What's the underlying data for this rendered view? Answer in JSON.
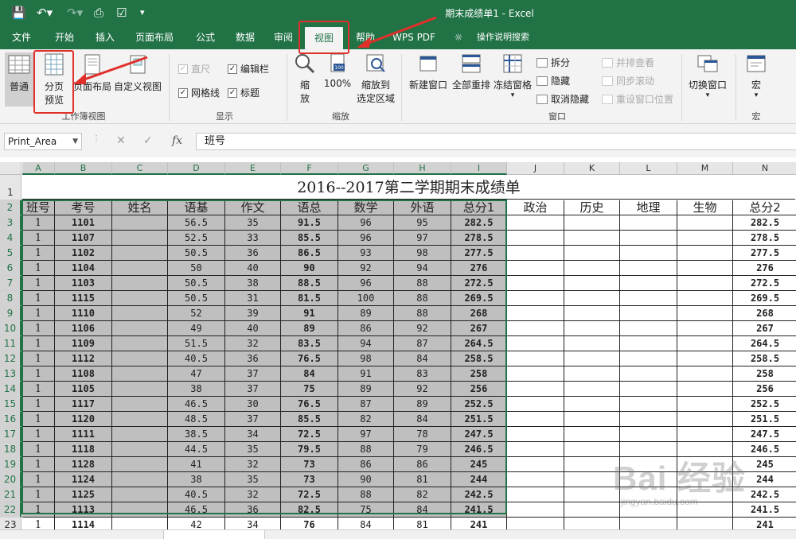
{
  "titlebar": {
    "title": "期末成绩单1  -  Excel"
  },
  "tabs": [
    {
      "label": "文件"
    },
    {
      "label": "开始"
    },
    {
      "label": "插入"
    },
    {
      "label": "页面布局"
    },
    {
      "label": "公式"
    },
    {
      "label": "数据"
    },
    {
      "label": "审阅"
    },
    {
      "label": "视图"
    },
    {
      "label": "帮助"
    },
    {
      "label": "WPS PDF"
    },
    {
      "label": "操作说明搜索"
    }
  ],
  "ribbon": {
    "views": {
      "normal": "普通",
      "page_break_1": "分页",
      "page_break_2": "预览",
      "page_layout": "页面布局",
      "custom_view": "自定义视图",
      "group": "工作簿视图"
    },
    "show": {
      "ruler": "直尺",
      "formula_bar": "编辑栏",
      "gridlines": "网格线",
      "headings": "标题",
      "group": "显示"
    },
    "zoom": {
      "zoom_1": "缩",
      "zoom_2": "放",
      "hundred": "100%",
      "to_sel_1": "缩放到",
      "to_sel_2": "选定区域",
      "group": "缩放"
    },
    "window": {
      "new_window": "新建窗口",
      "arrange_all": "全部重排",
      "freeze": "冻结窗格",
      "split": "拆分",
      "hide": "隐藏",
      "unhide": "取消隐藏",
      "side_by_side": "并排查看",
      "sync_scroll": "同步滚动",
      "reset_pos": "重设窗口位置",
      "switch": "切换窗口",
      "group": "窗口"
    },
    "macros": {
      "label": "宏",
      "group": "宏"
    }
  },
  "formulabar": {
    "namebox": "Print_Area",
    "content": "班号"
  },
  "sheet": {
    "columns": [
      "A",
      "B",
      "C",
      "D",
      "E",
      "F",
      "G",
      "H",
      "I",
      "J",
      "K",
      "L",
      "M",
      "N"
    ],
    "title": "2016--2017第二学期期末成绩单",
    "headers": [
      "班号",
      "考号",
      "姓名",
      "语基",
      "作文",
      "语总",
      "数学",
      "外语",
      "总分1",
      "政治",
      "历史",
      "地理",
      "生物",
      "总分2"
    ],
    "rows": [
      {
        "n": "3",
        "v": [
          "1",
          "1101",
          "",
          "56.5",
          "35",
          "91.5",
          "96",
          "95",
          "282.5",
          "",
          "",
          "",
          "",
          "282.5"
        ]
      },
      {
        "n": "4",
        "v": [
          "1",
          "1107",
          "",
          "52.5",
          "33",
          "85.5",
          "96",
          "97",
          "278.5",
          "",
          "",
          "",
          "",
          "278.5"
        ]
      },
      {
        "n": "5",
        "v": [
          "1",
          "1102",
          "",
          "50.5",
          "36",
          "86.5",
          "93",
          "98",
          "277.5",
          "",
          "",
          "",
          "",
          "277.5"
        ]
      },
      {
        "n": "6",
        "v": [
          "1",
          "1104",
          "",
          "50",
          "40",
          "90",
          "92",
          "94",
          "276",
          "",
          "",
          "",
          "",
          "276"
        ]
      },
      {
        "n": "7",
        "v": [
          "1",
          "1103",
          "",
          "50.5",
          "38",
          "88.5",
          "96",
          "88",
          "272.5",
          "",
          "",
          "",
          "",
          "272.5"
        ]
      },
      {
        "n": "8",
        "v": [
          "1",
          "1115",
          "",
          "50.5",
          "31",
          "81.5",
          "100",
          "88",
          "269.5",
          "",
          "",
          "",
          "",
          "269.5"
        ]
      },
      {
        "n": "9",
        "v": [
          "1",
          "1110",
          "",
          "52",
          "39",
          "91",
          "89",
          "88",
          "268",
          "",
          "",
          "",
          "",
          "268"
        ]
      },
      {
        "n": "10",
        "v": [
          "1",
          "1106",
          "",
          "49",
          "40",
          "89",
          "86",
          "92",
          "267",
          "",
          "",
          "",
          "",
          "267"
        ]
      },
      {
        "n": "11",
        "v": [
          "1",
          "1109",
          "",
          "51.5",
          "32",
          "83.5",
          "94",
          "87",
          "264.5",
          "",
          "",
          "",
          "",
          "264.5"
        ]
      },
      {
        "n": "12",
        "v": [
          "1",
          "1112",
          "",
          "40.5",
          "36",
          "76.5",
          "98",
          "84",
          "258.5",
          "",
          "",
          "",
          "",
          "258.5"
        ]
      },
      {
        "n": "13",
        "v": [
          "1",
          "1108",
          "",
          "47",
          "37",
          "84",
          "91",
          "83",
          "258",
          "",
          "",
          "",
          "",
          "258"
        ]
      },
      {
        "n": "14",
        "v": [
          "1",
          "1105",
          "",
          "38",
          "37",
          "75",
          "89",
          "92",
          "256",
          "",
          "",
          "",
          "",
          "256"
        ]
      },
      {
        "n": "15",
        "v": [
          "1",
          "1117",
          "",
          "46.5",
          "30",
          "76.5",
          "87",
          "89",
          "252.5",
          "",
          "",
          "",
          "",
          "252.5"
        ]
      },
      {
        "n": "16",
        "v": [
          "1",
          "1120",
          "",
          "48.5",
          "37",
          "85.5",
          "82",
          "84",
          "251.5",
          "",
          "",
          "",
          "",
          "251.5"
        ]
      },
      {
        "n": "17",
        "v": [
          "1",
          "1111",
          "",
          "38.5",
          "34",
          "72.5",
          "97",
          "78",
          "247.5",
          "",
          "",
          "",
          "",
          "247.5"
        ]
      },
      {
        "n": "18",
        "v": [
          "1",
          "1118",
          "",
          "44.5",
          "35",
          "79.5",
          "88",
          "79",
          "246.5",
          "",
          "",
          "",
          "",
          "246.5"
        ]
      },
      {
        "n": "19",
        "v": [
          "1",
          "1128",
          "",
          "41",
          "32",
          "73",
          "86",
          "86",
          "245",
          "",
          "",
          "",
          "",
          "245"
        ]
      },
      {
        "n": "20",
        "v": [
          "1",
          "1124",
          "",
          "38",
          "35",
          "73",
          "90",
          "81",
          "244",
          "",
          "",
          "",
          "",
          "244"
        ]
      },
      {
        "n": "21",
        "v": [
          "1",
          "1125",
          "",
          "40.5",
          "32",
          "72.5",
          "88",
          "82",
          "242.5",
          "",
          "",
          "",
          "",
          "242.5"
        ]
      },
      {
        "n": "22",
        "v": [
          "1",
          "1113",
          "",
          "46.5",
          "36",
          "82.5",
          "75",
          "84",
          "241.5",
          "",
          "",
          "",
          "",
          "241.5"
        ]
      },
      {
        "n": "23",
        "v": [
          "1",
          "1114",
          "",
          "42",
          "34",
          "76",
          "84",
          "81",
          "241",
          "",
          "",
          "",
          "",
          "241"
        ]
      }
    ]
  },
  "watermark": {
    "main": "Bai 经验",
    "sub": "jingyan.baidu.com"
  },
  "colors": {
    "accent": "#217346",
    "highlight": "#e0302b",
    "shade": "#bfbfbf"
  }
}
